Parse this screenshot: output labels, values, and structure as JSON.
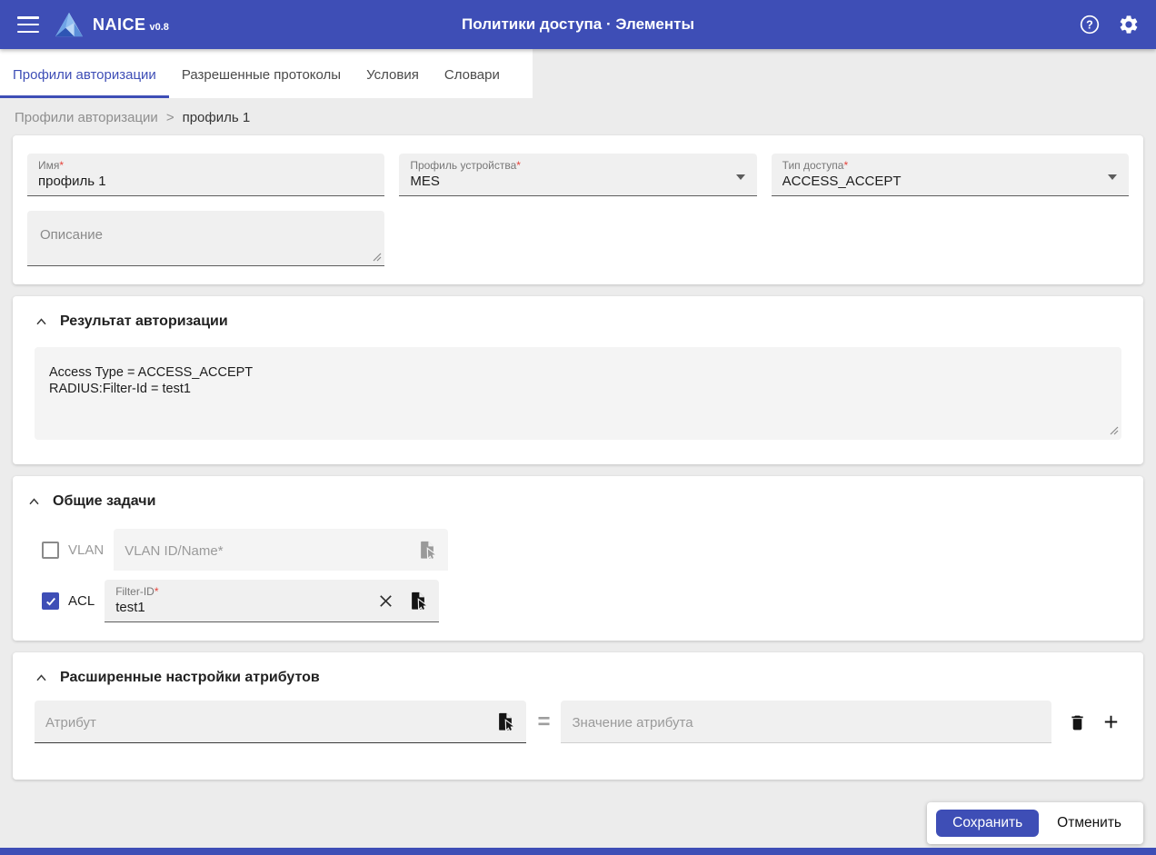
{
  "colors": {
    "primary": "#3e4eb6",
    "required_asterisk": "#e5433b"
  },
  "header": {
    "app_name": "NAICE",
    "app_version": "v0.8",
    "title": "Политики доступа · Элементы"
  },
  "icons": {
    "menu": "hamburger-icon",
    "help": "help-circle-icon",
    "settings": "gear-icon",
    "collapse": "chevron-up-icon",
    "select_from_list": "file-select-icon",
    "clear": "close-icon",
    "delete": "trash-icon",
    "add": "plus-icon"
  },
  "tabs": [
    {
      "label": "Профили авторизации",
      "active": true
    },
    {
      "label": "Разрешенные протоколы",
      "active": false
    },
    {
      "label": "Условия",
      "active": false
    },
    {
      "label": "Словари",
      "active": false
    }
  ],
  "breadcrumb": {
    "parent": "Профили авторизации",
    "separator": ">",
    "current": "профиль 1"
  },
  "form": {
    "name": {
      "label": "Имя",
      "required": "*",
      "value": "профиль 1"
    },
    "device_profile": {
      "label": "Профиль устройства",
      "required": "*",
      "value": "MES"
    },
    "access_type": {
      "label": "Тип доступа",
      "required": "*",
      "value": "ACCESS_ACCEPT"
    },
    "description": {
      "placeholder": "Описание"
    }
  },
  "authorization_result": {
    "title": "Результат авторизации",
    "content": "Access Type = ACCESS_ACCEPT\nRADIUS:Filter-Id = test1"
  },
  "common_tasks": {
    "title": "Общие задачи",
    "vlan": {
      "checkbox_label": "VLAN",
      "placeholder": "VLAN ID/Name*",
      "checked": false
    },
    "acl": {
      "checkbox_label": "ACL",
      "label": "Filter-ID",
      "required": "*",
      "value": "test1",
      "checked": true
    }
  },
  "advanced_attributes": {
    "title": "Расширенные настройки атрибутов",
    "attribute_placeholder": "Атрибут",
    "equals": "=",
    "value_placeholder": "Значение атрибута"
  },
  "actions": {
    "save": "Сохранить",
    "cancel": "Отменить"
  }
}
